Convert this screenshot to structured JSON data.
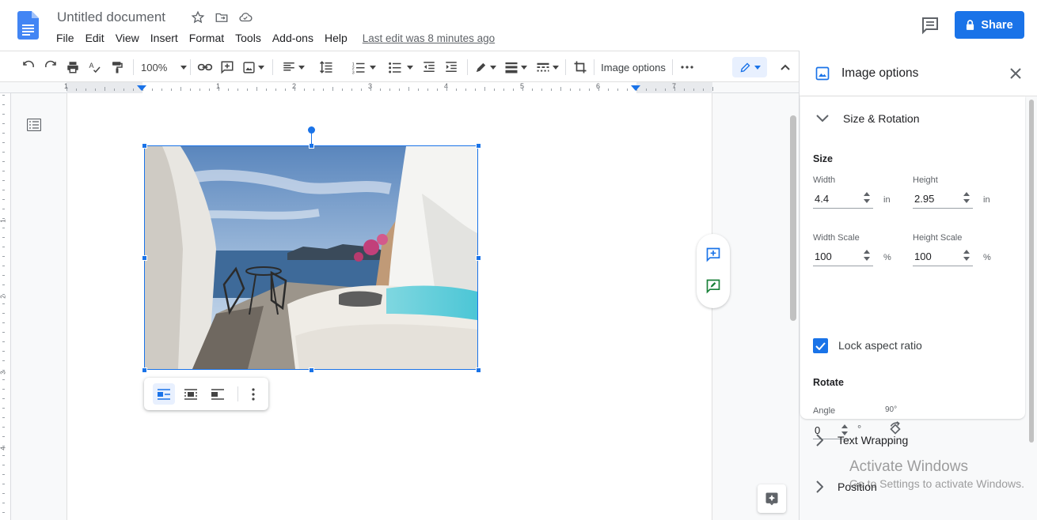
{
  "header": {
    "doc_title": "Untitled document",
    "menu": [
      "File",
      "Edit",
      "View",
      "Insert",
      "Format",
      "Tools",
      "Add-ons",
      "Help"
    ],
    "last_edit": "Last edit was 8 minutes ago",
    "share_label": "Share",
    "brand_color": "#1a73e8"
  },
  "toolbar": {
    "zoom": "100%",
    "image_options_label": "Image options",
    "more_label": "⋯"
  },
  "ruler": {
    "numbers": [
      "1",
      "1",
      "2",
      "3",
      "4",
      "5",
      "6",
      "7"
    ],
    "vertical_numbers": [
      "1",
      "2",
      "3",
      "4"
    ]
  },
  "panel": {
    "title": "Image options",
    "size_rotation": {
      "heading": "Size & Rotation",
      "size_label": "Size",
      "width_label": "Width",
      "width_value": "4.4",
      "width_unit": "in",
      "height_label": "Height",
      "height_value": "2.95",
      "height_unit": "in",
      "width_scale_label": "Width Scale",
      "width_scale_value": "100",
      "height_scale_label": "Height Scale",
      "height_scale_value": "100",
      "percent_unit": "%",
      "lock_label": "Lock aspect ratio",
      "rotate_label": "Rotate",
      "angle_label": "Angle",
      "angle_value": "0",
      "degree_unit": "°",
      "rotate90_label": "90°"
    },
    "text_wrapping": "Text Wrapping",
    "position": "Position"
  },
  "watermark": {
    "line1": "Activate Windows",
    "line2": "Go to Settings to activate Windows."
  }
}
